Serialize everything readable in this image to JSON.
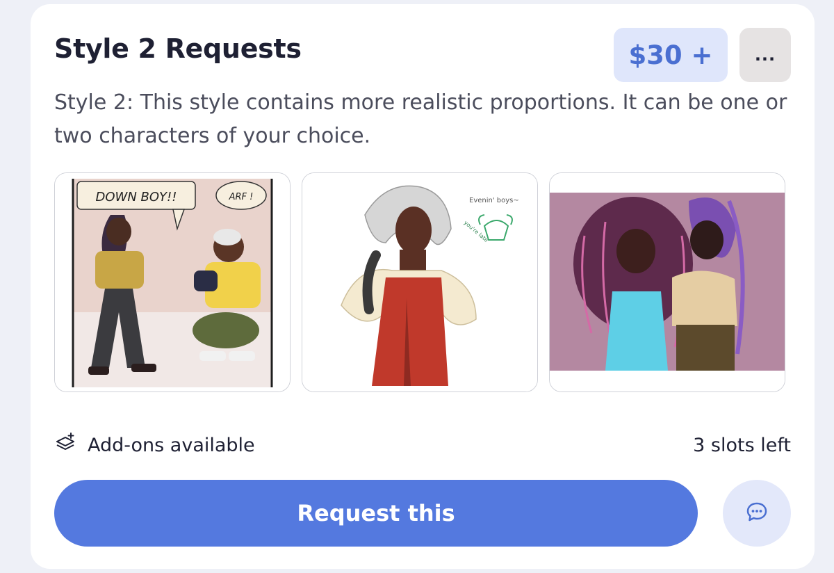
{
  "card": {
    "title": "Style 2 Requests",
    "price": "$30 +",
    "more_label": "...",
    "description": "Style 2: This style contains more realistic proportions. It can be one or two characters of your choice."
  },
  "gallery": {
    "items": [
      {
        "speech_1": "DOWN BOY!!",
        "speech_2": "ARF !"
      },
      {
        "caption_1": "Evenin' boys~",
        "caption_2": "you're late"
      },
      {}
    ]
  },
  "meta": {
    "addons_label": "Add-ons available",
    "slots_label": "3 slots left"
  },
  "actions": {
    "request_label": "Request this"
  },
  "colors": {
    "accent": "#5479df",
    "price_bg": "#dfe6fb",
    "price_text": "#4a6fd1",
    "more_bg": "#e6e3e3",
    "chat_bg": "#e3e8fa"
  },
  "icons": {
    "addons": "layers-plus-icon",
    "more": "ellipsis-icon",
    "chat": "chat-bubble-icon"
  }
}
